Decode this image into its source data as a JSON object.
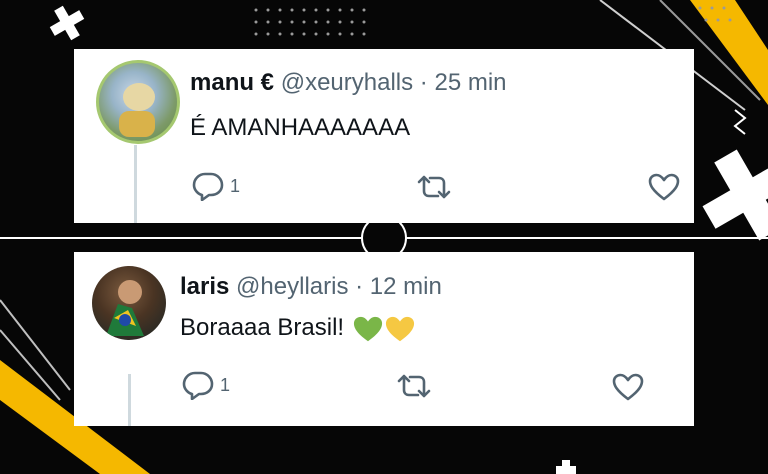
{
  "colors": {
    "background": "#060606",
    "accent_yellow": "#f5b800",
    "card": "#ffffff",
    "name": "#0f1419",
    "muted": "#536471",
    "heart_green": "#7ab648",
    "heart_yellow": "#f5c842"
  },
  "tweets": [
    {
      "name": "manu €",
      "handle": "@xeuryhalls",
      "separator": "·",
      "time": "25 min",
      "text": "É AMANHAAAAAAA",
      "reply_count": "1",
      "icons": [
        "reply-icon",
        "retweet-icon",
        "like-icon"
      ]
    },
    {
      "name": "laris",
      "handle": "@heyllaris",
      "separator": "·",
      "time": "12 min",
      "text": "Boraaaa Brasil!",
      "emojis": [
        "green-heart-emoji",
        "yellow-heart-emoji"
      ],
      "reply_count": "1",
      "icons": [
        "reply-icon",
        "retweet-icon",
        "like-icon"
      ]
    }
  ]
}
